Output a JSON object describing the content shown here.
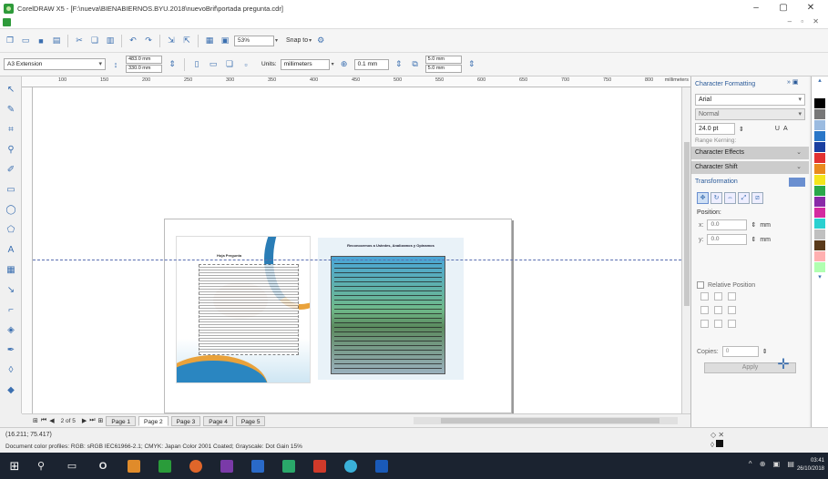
{
  "window": {
    "title": "CorelDRAW X5 - [F:\\nueva\\BIENABIERNOS.BYU.2018\\nuevoBrif\\portada pregunta.cdr]",
    "minimize": "–",
    "maximize": "▢",
    "close": "✕",
    "mdi_controls": "– ▫ ✕"
  },
  "toolbar": {
    "zoom": "53%",
    "snap_to": "Snap to"
  },
  "property_bar": {
    "preset": "A3 Extension",
    "width": "483.0 mm",
    "height": "330.0 mm",
    "units_label": "Units:",
    "units": "millimeters",
    "nudge": "0.1 mm",
    "dup_x": "5.0 mm",
    "dup_y": "5.0 mm"
  },
  "ruler": {
    "ticks": [
      "100",
      "150",
      "200",
      "250",
      "300",
      "350",
      "400",
      "450",
      "500",
      "550",
      "600",
      "650",
      "700",
      "750",
      "800"
    ],
    "units": "millimeters"
  },
  "document": {
    "left_title": "Hoja Pregunta",
    "right_title": "Reconocemos a Ustedes, Analizamos y Opinamos"
  },
  "pagebar": {
    "count": "2 of 5",
    "tabs": [
      "Page 1",
      "Page 2",
      "Page 3",
      "Page 4",
      "Page 5"
    ],
    "active_index": 1
  },
  "docker": {
    "title": "Character Formatting",
    "font": "Arial",
    "style": "Normal",
    "size": "24.0 pt",
    "range_kerning": "Range Kerning:",
    "effects": "Character Effects",
    "shift": "Character Shift",
    "transformation": "Transformation",
    "position_label": "Position:",
    "pos_x": "0.0",
    "pos_y": "0.0",
    "unit": "mm",
    "relative": "Relative Position",
    "copies_label": "Copies:",
    "copies": "0",
    "apply": "Apply"
  },
  "palette": {
    "colors": [
      "#ffffff",
      "#000000",
      "#777777",
      "#9bbbe0",
      "#2a77c8",
      "#1a3fa0",
      "#e23131",
      "#e98a1e",
      "#f4e51c",
      "#2aa84a",
      "#8a2aa8",
      "#d42aa0",
      "#2ad0d0",
      "#c0c0c0",
      "#5a3a1a",
      "#ffb0b0",
      "#b0ffb0"
    ]
  },
  "status": {
    "coords": "(16.211; 75.417)",
    "color_profile": "Document color profiles: RGB: sRGB IEC61966-2.1; CMYK: Japan Color 2001 Coated; Grayscale: Dot Gain 15%"
  },
  "taskbar": {
    "time": "03:41",
    "date": "26/10/2018",
    "tray": "^ ⊕ ▣ ▤"
  }
}
